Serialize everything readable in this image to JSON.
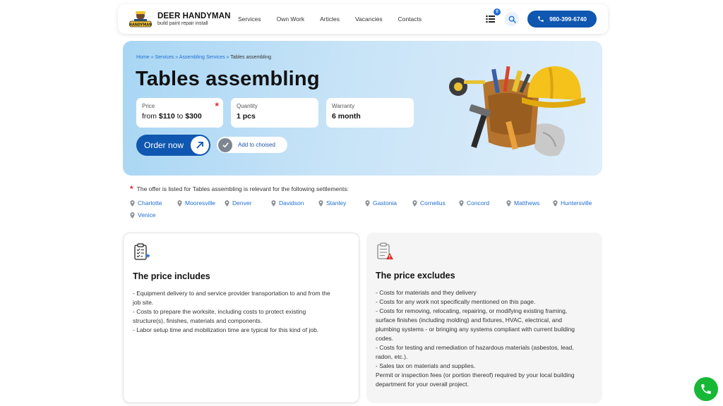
{
  "header": {
    "brand": "DEER HANDYMAN",
    "tagline": "build paint repair install",
    "nav": [
      "Services",
      "Own Work",
      "Articles",
      "Vacancies",
      "Contacts"
    ],
    "list_badge": "0",
    "phone": "980-399-6740"
  },
  "hero": {
    "breadcrumb": {
      "home": "Home",
      "sep": "»",
      "services": "Services",
      "assembling": "Assembling Services",
      "current": "Tables assembling"
    },
    "title": "Tables assembling",
    "price": {
      "label": "Price",
      "from": "from",
      "min": "$110",
      "to": "to",
      "max": "$300"
    },
    "quantity": {
      "label": "Quantity",
      "value": "1 pcs"
    },
    "warranty": {
      "label": "Warranty",
      "value": "6 month"
    },
    "order_label": "Order now",
    "choice_label": "Add to choised"
  },
  "settlements": {
    "notice": "The offer is listed for Tables assembling is relevant for the following settlements:",
    "cities": [
      "Charlotte",
      "Mooresville",
      "Denver",
      "Davidson",
      "Stanley",
      "Gastonia",
      "Cornelius",
      "Concord",
      "Matthews",
      "Huntersville",
      "Venice"
    ]
  },
  "includes": {
    "title": "The price includes",
    "lines": [
      "- Equipment delivery to and service provider transportation to and from the",
      "job site.",
      "- Costs to prepare the worksite, including costs to protect existing",
      "structure(s), finishes, materials and components.",
      "- Labor setup time and mobilization time are typical for this kind of job."
    ]
  },
  "excludes": {
    "title": "The price excludes",
    "lines": [
      "- Costs for materials and they delivery",
      "- Costs for any work not specifically mentioned on this page.",
      "- Costs for removing, relocating, repairing, or modifying existing framing,",
      "surface finishes (including molding) and fixtures, HVAC, electrical, and",
      "plumbing systems - or bringing any systems compliant with current building",
      "codes.",
      "- Costs for testing and remediation of hazardous materials (asbestos, lead,",
      "radon, etc.).",
      "- Sales tax on materials and supplies.",
      "Permit or inspection fees (or portion thereof) required by your local building",
      "department for your overall project."
    ]
  },
  "colors": {
    "accent": "#0f57b0",
    "link": "#1f6fd1",
    "star": "#e12b2b",
    "call": "#18b837"
  }
}
